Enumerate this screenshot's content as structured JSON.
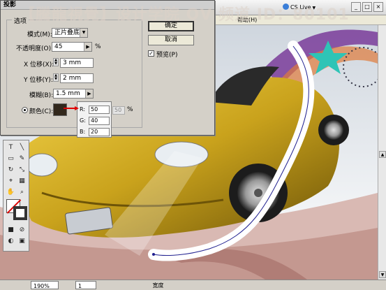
{
  "watermark": "【騰龍視覺】设计学院 QV 频道 ID：80101",
  "appbar": {
    "cslive": "CS Live",
    "min": "_",
    "max": "□",
    "close": "×"
  },
  "menubar": {
    "help": "帮助(H)"
  },
  "dialog": {
    "title": "投影",
    "group_label": "选项",
    "mode_label": "模式(M):",
    "mode_value": "正片叠底",
    "opacity_label": "不透明度(O):",
    "opacity_value": "45",
    "opacity_unit": "%",
    "x_label": "X 位移(X):",
    "x_value": "3 mm",
    "y_label": "Y 位移(Y):",
    "y_value": "2 mm",
    "blur_label": "模糊(B):",
    "blur_value": "1.5 mm",
    "color_label": "颜色(C):",
    "dark_value": "50",
    "dark_unit": "%",
    "ok": "确定",
    "cancel": "取消",
    "preview": "预览(P)",
    "preview_checked": true,
    "color_swatch": "#32281c",
    "rgb": {
      "r_label": "R:",
      "r": "50",
      "g_label": "G:",
      "g": "40",
      "b_label": "B:",
      "b": "20"
    }
  },
  "statusbar": {
    "zoom": "190%",
    "page": "1",
    "mode": "宽度"
  },
  "colors": {
    "car": "#c9a21c",
    "road": "#e4c6c0",
    "stroke": "#1f1f8f"
  }
}
